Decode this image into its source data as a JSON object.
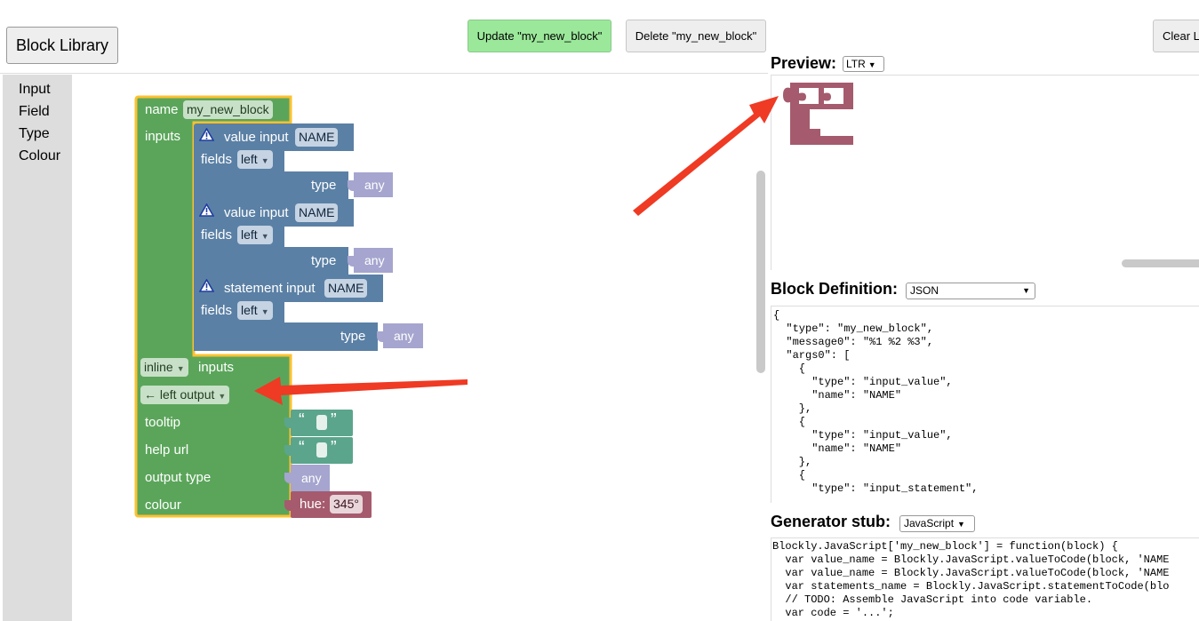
{
  "toolbar": {
    "block_library": "Block Library",
    "update": "Update \"my_new_block\"",
    "delete": "Delete \"my_new_block\"",
    "clear": "Clear L"
  },
  "toolbox": {
    "items": [
      "Input",
      "Field",
      "Type",
      "Colour"
    ]
  },
  "factory_block": {
    "name_label": "name",
    "name_value": "my_new_block",
    "inputs_label": "inputs",
    "inputs": [
      {
        "title": "value input",
        "name": "NAME",
        "fields_label": "fields",
        "align": "left",
        "type_label": "type",
        "type_value": "any"
      },
      {
        "title": "value input",
        "name": "NAME",
        "fields_label": "fields",
        "align": "left",
        "type_label": "type",
        "type_value": "any"
      },
      {
        "title": "statement input",
        "name": "NAME",
        "fields_label": "fields",
        "align": "left",
        "type_label": "type",
        "type_value": "any"
      }
    ],
    "inline_value": "inline",
    "inline_suffix": "inputs",
    "output_value": "← left output",
    "tooltip_label": "tooltip",
    "helpurl_label": "help url",
    "quote_open": "“",
    "quote_close": "”",
    "output_type_label": "output type",
    "output_type_value": "any",
    "colour_label": "colour",
    "hue_label": "hue:",
    "hue_value": "345°"
  },
  "preview": {
    "title": "Preview:",
    "direction": "LTR",
    "block_colour": "#a55b6d"
  },
  "block_definition": {
    "title": "Block Definition:",
    "format": "JSON",
    "code": "{\n  \"type\": \"my_new_block\",\n  \"message0\": \"%1 %2 %3\",\n  \"args0\": [\n    {\n      \"type\": \"input_value\",\n      \"name\": \"NAME\"\n    },\n    {\n      \"type\": \"input_value\",\n      \"name\": \"NAME\"\n    },\n    {\n      \"type\": \"input_statement\","
  },
  "generator_stub": {
    "title": "Generator stub:",
    "language": "JavaScript",
    "code": "Blockly.JavaScript['my_new_block'] = function(block) {\n  var value_name = Blockly.JavaScript.valueToCode(block, 'NAME\n  var value_name = Blockly.JavaScript.valueToCode(block, 'NAME\n  var statements_name = Blockly.JavaScript.statementToCode(blo\n  // TODO: Assemble JavaScript into code variable.\n  var code = '...';"
  },
  "colors": {
    "factory_green": "#5ba55b",
    "input_blue": "#5b80a5",
    "type_purple": "#a5a5cf",
    "text_teal": "#5ba58c",
    "colour_red": "#a55b6d",
    "selection_yellow": "#fcc12f",
    "arrow_red": "#ef3a24",
    "update_green": "#9be89b"
  }
}
